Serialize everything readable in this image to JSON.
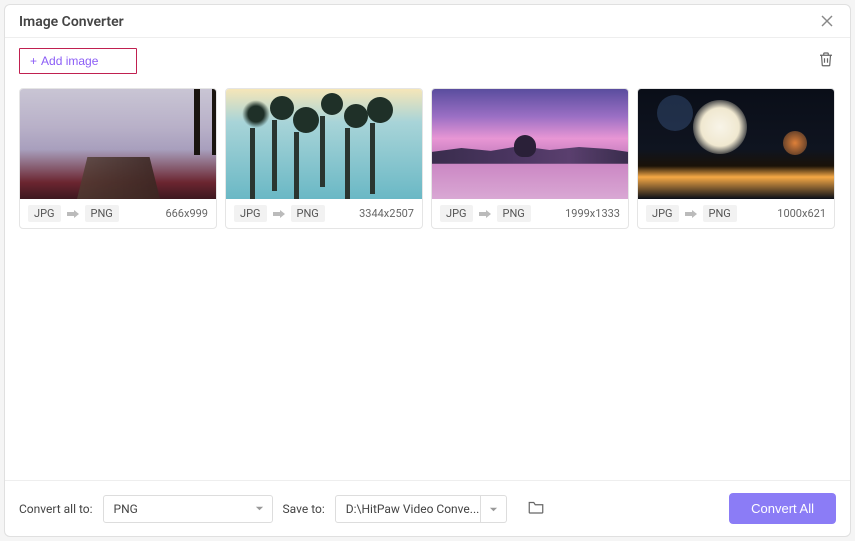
{
  "titlebar": {
    "title": "Image Converter"
  },
  "toolbar": {
    "add_image_label": "Add image"
  },
  "images": [
    {
      "src_format": "JPG",
      "dst_format": "PNG",
      "dimensions": "666x999"
    },
    {
      "src_format": "JPG",
      "dst_format": "PNG",
      "dimensions": "3344x2507"
    },
    {
      "src_format": "JPG",
      "dst_format": "PNG",
      "dimensions": "1999x1333"
    },
    {
      "src_format": "JPG",
      "dst_format": "PNG",
      "dimensions": "1000x621"
    }
  ],
  "footer": {
    "convert_all_to_label": "Convert all to:",
    "format_selected": "PNG",
    "save_to_label": "Save to:",
    "save_path": "D:\\HitPaw Video Conve...",
    "convert_all_button": "Convert All"
  }
}
